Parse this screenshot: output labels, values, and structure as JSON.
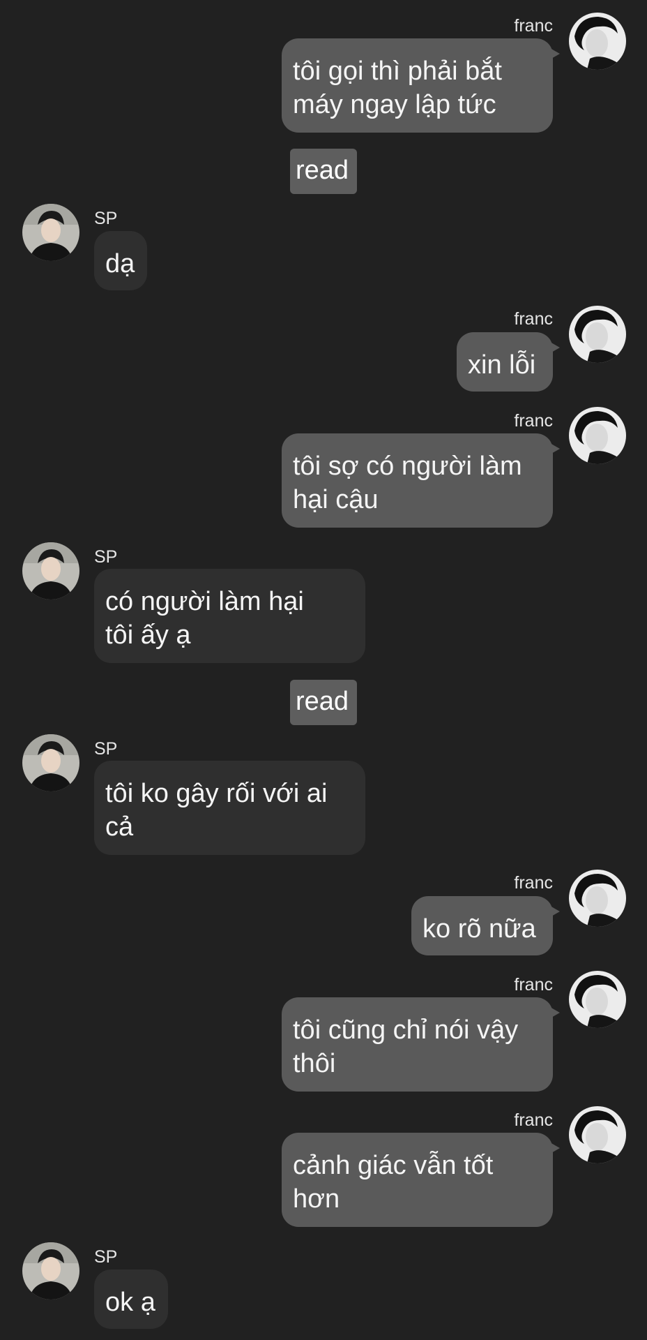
{
  "participants": {
    "me": {
      "name": "franc",
      "avatar_icon": "franc-avatar"
    },
    "other": {
      "name": "SP",
      "avatar_icon": "sp-avatar"
    }
  },
  "messages": [
    {
      "sender": "franc",
      "text": "tôi gọi thì phải bắt\nmáy ngay lập tức"
    },
    {
      "read_receipt": "read"
    },
    {
      "sender": "SP",
      "text": "dạ"
    },
    {
      "sender": "franc",
      "text": "xin lỗi"
    },
    {
      "sender": "franc",
      "text": "tôi sợ có người làm\nhại cậu"
    },
    {
      "sender": "SP",
      "text": "có người làm hại\ntôi ấy ạ"
    },
    {
      "read_receipt": "read"
    },
    {
      "sender": "SP",
      "text": "tôi ko gây rối với ai\ncả"
    },
    {
      "sender": "franc",
      "text": "ko rõ nữa"
    },
    {
      "sender": "franc",
      "text": "tôi cũng chỉ nói vậy\nthôi"
    },
    {
      "sender": "franc",
      "text": "cảnh giác vẫn tốt\nhơn"
    },
    {
      "sender": "SP",
      "text": "ok ạ"
    }
  ],
  "colors": {
    "background": "#212121",
    "outgoing_bubble": "#5a5a5a",
    "incoming_bubble": "#2f2f2f",
    "read_badge": "#5e5e5e"
  }
}
